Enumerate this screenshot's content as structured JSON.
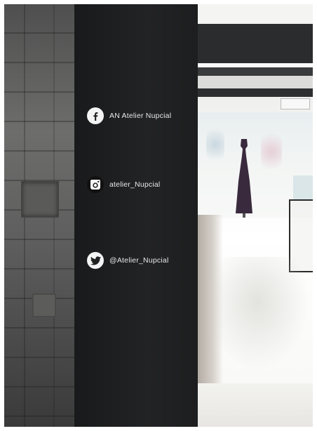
{
  "social": {
    "facebook": {
      "label": "AN Atelier Nupcial",
      "icon": "facebook-icon"
    },
    "instagram": {
      "label": "atelier_Nupcial",
      "icon": "instagram-icon"
    },
    "twitter": {
      "label": "@Atelier_Nupcial",
      "icon": "twitter-icon"
    }
  },
  "colors": {
    "column": "#1f2021",
    "label_text": "#e8e8e8",
    "icon_bg": "#f4f4f4"
  }
}
